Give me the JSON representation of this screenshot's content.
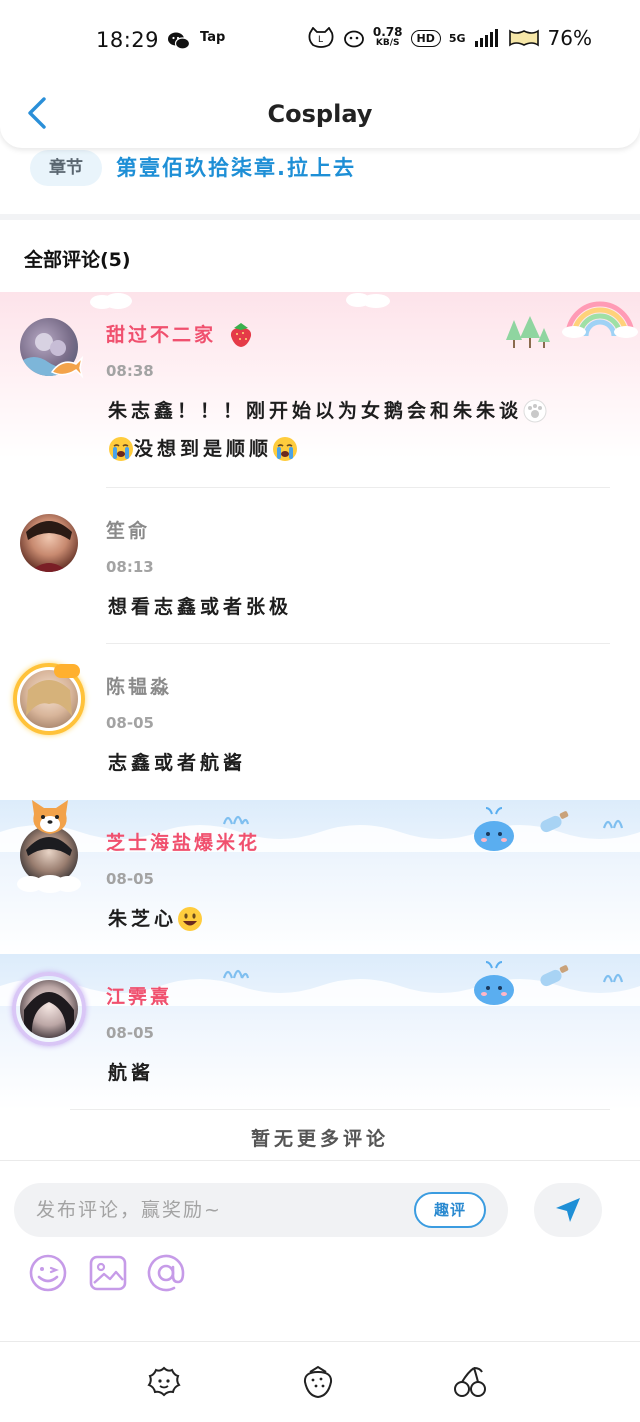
{
  "status_bar": {
    "time": "18:29",
    "app_label": "Tap",
    "speed_top": "0.78",
    "speed_bottom": "KB/S",
    "hd": "HD",
    "network": "5G",
    "battery": "76%"
  },
  "header": {
    "title": "Cosplay"
  },
  "chapter": {
    "badge": "章节",
    "title": "第壹佰玖拾柒章.拉上去"
  },
  "comments_section": {
    "title": "全部评论(5)"
  },
  "comments": [
    {
      "username": "甜过不二家",
      "time": "08:38",
      "text_line1": "朱志鑫！！！刚开始以为女鹅会和朱朱谈",
      "text_line2": "没想到是顺顺"
    },
    {
      "username": "笙俞",
      "time": "08:13",
      "text_line1": "想看志鑫或者张极"
    },
    {
      "username": "陈韫淼",
      "time": "08-05",
      "text_line1": "志鑫或者航酱"
    },
    {
      "username": "芝士海盐爆米花",
      "time": "08-05",
      "text_line1": "朱芝心"
    },
    {
      "username": "江霁熹",
      "time": "08-05",
      "text_line1": "航酱"
    }
  ],
  "no_more": "暂无更多评论",
  "input": {
    "placeholder": "发布评论，赢奖励~",
    "quick_review": "趣评"
  },
  "colors": {
    "accent_blue": "#1e8fd6",
    "username_pink": "#f0506e",
    "icon_purple": "#c69be8"
  }
}
